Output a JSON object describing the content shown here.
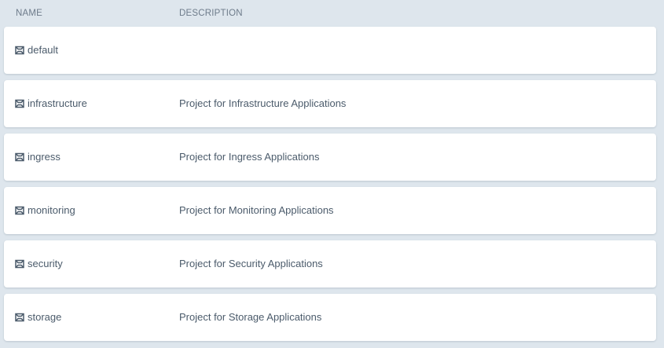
{
  "header": {
    "name_label": "NAME",
    "description_label": "DESCRIPTION"
  },
  "projects": [
    {
      "name": "default",
      "description": "",
      "icon": "project-icon"
    },
    {
      "name": "infrastructure",
      "description": "Project for Infrastructure Applications",
      "icon": "project-icon"
    },
    {
      "name": "ingress",
      "description": "Project for Ingress Applications",
      "icon": "project-icon"
    },
    {
      "name": "monitoring",
      "description": "Project for Monitoring Applications",
      "icon": "project-icon"
    },
    {
      "name": "security",
      "description": "Project for Security Applications",
      "icon": "project-icon"
    },
    {
      "name": "storage",
      "description": "Project for Storage Applications",
      "icon": "project-icon"
    }
  ],
  "colors": {
    "background": "#dee6ed",
    "row": "#ffffff",
    "text": "#4b5b6b",
    "header_text": "#6d7b8a"
  }
}
